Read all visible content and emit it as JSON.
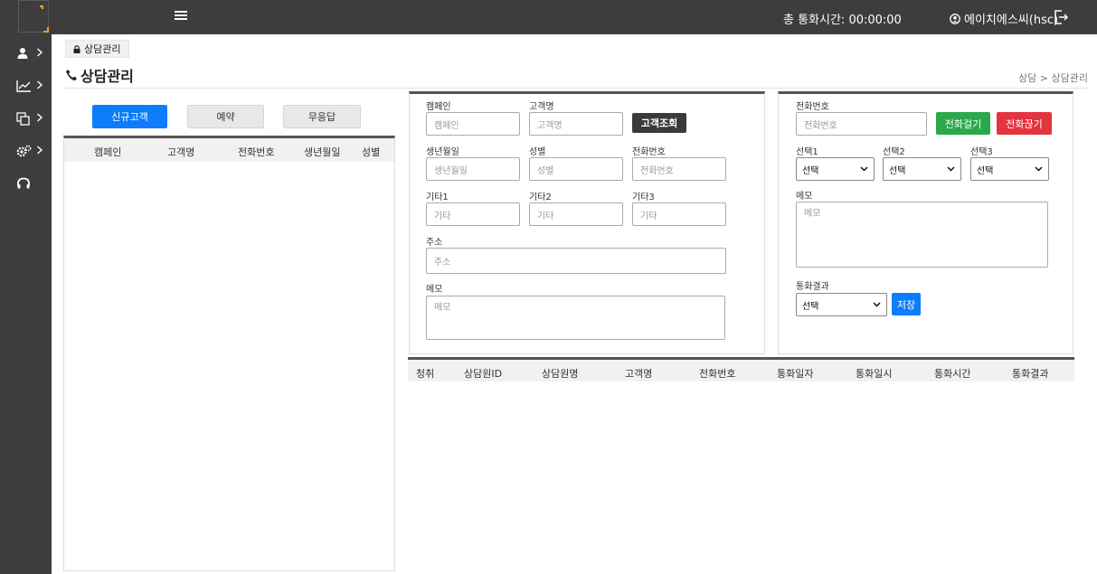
{
  "header": {
    "call_time": "총 통화시간: 00:00:00",
    "user": "에이치에스씨(hsc)"
  },
  "sidebar": {
    "items": [
      {
        "icon": "user-icon"
      },
      {
        "icon": "chart-icon"
      },
      {
        "icon": "copy-icon"
      },
      {
        "icon": "gears-icon"
      },
      {
        "icon": "headset-icon"
      }
    ]
  },
  "page": {
    "tag": "상담관리",
    "title": "상담관리",
    "breadcrumb": "상담 > 상담관리"
  },
  "left": {
    "tabs": [
      "신규고객",
      "예약",
      "무응답"
    ],
    "columns": [
      "캠페인",
      "고객명",
      "전화번호",
      "생년월일",
      "성별"
    ]
  },
  "form": {
    "campaign_label": "캠페인",
    "campaign_placeholder": "캠페인",
    "name_label": "고객명",
    "name_placeholder": "고객명",
    "search_button": "고객조회",
    "birth_label": "생년월일",
    "birth_placeholder": "생년월일",
    "gender_label": "성별",
    "gender_placeholder": "성별",
    "phone_label": "전화번호",
    "phone_placeholder": "전화번호",
    "etc1_label": "기타1",
    "etc1_placeholder": "기타",
    "etc2_label": "기타2",
    "etc2_placeholder": "기타",
    "etc3_label": "기타3",
    "etc3_placeholder": "기타",
    "address_label": "주소",
    "address_placeholder": "주소",
    "memo_label": "메모",
    "memo_placeholder": "메모"
  },
  "call": {
    "phone_label": "전화번호",
    "phone_placeholder": "전화번호",
    "dial_button": "전화걸기",
    "hangup_button": "전화끊기",
    "select1_label": "선택1",
    "select2_label": "선택2",
    "select3_label": "선택3",
    "select_value": "선택",
    "memo_label": "메모",
    "memo_placeholder": "메모",
    "result_label": "통화결과",
    "save_button": "저장"
  },
  "history": {
    "columns": [
      "청취",
      "상담원ID",
      "상담원명",
      "고객명",
      "전화번호",
      "통화일자",
      "통화일시",
      "통화시간",
      "통화결과"
    ]
  },
  "colors": {
    "topbar": "#3d3d3d",
    "primary": "#0d7dfb",
    "green": "#2aa84a",
    "red": "#e3343f",
    "logo_accent": "#f0a030"
  }
}
